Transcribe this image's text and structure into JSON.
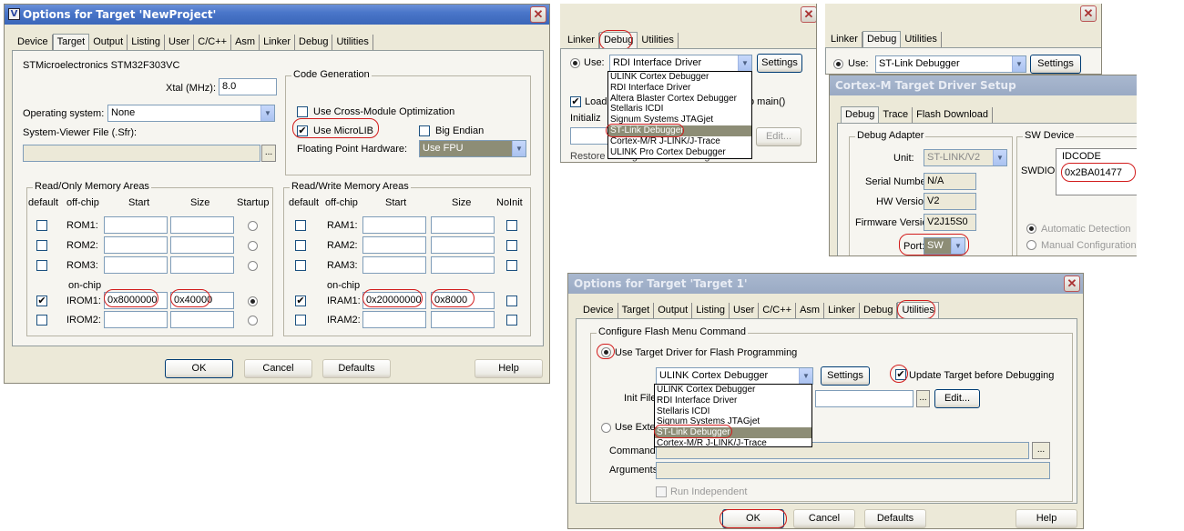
{
  "d1": {
    "title": "Options for Target 'NewProject'",
    "tabs": [
      "Device",
      "Target",
      "Output",
      "Listing",
      "User",
      "C/C++",
      "Asm",
      "Linker",
      "Debug",
      "Utilities"
    ],
    "device": "STMicroelectronics STM32F303VC",
    "xtal_label": "Xtal (MHz):",
    "xtal": "8.0",
    "os_label": "Operating system:",
    "os": "None",
    "svf_label": "System-Viewer File (.Sfr):",
    "dots": "...",
    "codegen": "Code Generation",
    "cross_module": "Use Cross-Module Optimization",
    "microlib": "Use MicroLIB",
    "big_endian": "Big Endian",
    "fpu_label": "Floating Point Hardware:",
    "fpu": "Use FPU",
    "ro_title": "Read/Only Memory Areas",
    "rw_title": "Read/Write Memory Areas",
    "ro_headers": {
      "default": "default",
      "offchip": "off-chip",
      "start": "Start",
      "size": "Size",
      "startup": "Startup"
    },
    "rw_headers": {
      "default": "default",
      "offchip": "off-chip",
      "start": "Start",
      "size": "Size",
      "noinit": "NoInit"
    },
    "onchip": "on-chip",
    "ro_rows": [
      {
        "name": "ROM1:",
        "start": "",
        "size": ""
      },
      {
        "name": "ROM2:",
        "start": "",
        "size": ""
      },
      {
        "name": "ROM3:",
        "start": "",
        "size": ""
      },
      {
        "name": "IROM1:",
        "start": "0x8000000",
        "size": "0x40000"
      },
      {
        "name": "IROM2:",
        "start": "",
        "size": ""
      }
    ],
    "rw_rows": [
      {
        "name": "RAM1:",
        "start": "",
        "size": ""
      },
      {
        "name": "RAM2:",
        "start": "",
        "size": ""
      },
      {
        "name": "RAM3:",
        "start": "",
        "size": ""
      },
      {
        "name": "IRAM1:",
        "start": "0x20000000",
        "size": "0x8000"
      },
      {
        "name": "IRAM2:",
        "start": "",
        "size": ""
      }
    ],
    "buttons": {
      "ok": "OK",
      "cancel": "Cancel",
      "defaults": "Defaults",
      "help": "Help"
    }
  },
  "d2": {
    "tabs": [
      "Linker",
      "Debug",
      "Utilities"
    ],
    "use": "Use:",
    "selected": "RDI Interface Driver",
    "settings": "Settings",
    "options": [
      "ULINK Cortex Debugger",
      "RDI Interface Driver",
      "Altera Blaster Cortex Debugger",
      "Stellaris ICDI",
      "Signum Systems JTAGjet",
      "ST-Link Debugger",
      "Cortex-M/R J-LINK/J-Trace",
      "ULINK Pro Cortex Debugger"
    ],
    "load": "Load",
    "initializ": "Initializ",
    "main_frag": "o main()",
    "edit": "Edit...",
    "restore": "Restore Debug Session Settings"
  },
  "d3": {
    "tabs": [
      "Linker",
      "Debug",
      "Utilities"
    ],
    "use": "Use:",
    "selected": "ST-Link Debugger",
    "settings": "Settings",
    "sub_title": "Cortex-M Target Driver Setup",
    "sub_tabs": [
      "Debug",
      "Trace",
      "Flash Download"
    ],
    "adapter": "Debug Adapter",
    "unit_label": "Unit:",
    "unit": "ST-LINK/V2",
    "serial_label": "Serial Number:",
    "serial": "N/A",
    "hw_label": "HW Version:",
    "hw": "V2",
    "fw_label": "Firmware Version:",
    "fw": "V2J15S0",
    "port_label": "Port:",
    "port": "SW",
    "swdev": "SW Device",
    "swdio": "SWDIO",
    "idcode_label": "IDCODE",
    "idcode": "0x2BA01477",
    "auto": "Automatic Detection",
    "manual": "Manual Configuration"
  },
  "d4": {
    "title": "Options for Target 'Target 1'",
    "tabs": [
      "Device",
      "Target",
      "Output",
      "Listing",
      "User",
      "C/C++",
      "Asm",
      "Linker",
      "Debug",
      "Utilities"
    ],
    "group": "Configure Flash Menu Command",
    "use_target": "Use Target Driver for Flash Programming",
    "selected": "ULINK Cortex Debugger",
    "settings": "Settings",
    "update": "Update Target before Debugging",
    "options": [
      "ULINK Cortex Debugger",
      "RDI Interface Driver",
      "Stellaris ICDI",
      "Signum Systems JTAGjet",
      "ST-Link Debugger",
      "Cortex-M/R J-LINK/J-Trace"
    ],
    "init_label": "Init File:",
    "edit": "Edit...",
    "dots": "...",
    "use_ext": "Use Exter",
    "command_label": "Command:",
    "arguments_label": "Arguments:",
    "run_indep": "Run Independent",
    "buttons": {
      "ok": "OK",
      "cancel": "Cancel",
      "defaults": "Defaults",
      "help": "Help"
    }
  },
  "colors": {
    "highlight": "#d21c1c",
    "title_active": "#3a66b9",
    "dialog_bg": "#ece9d8"
  }
}
